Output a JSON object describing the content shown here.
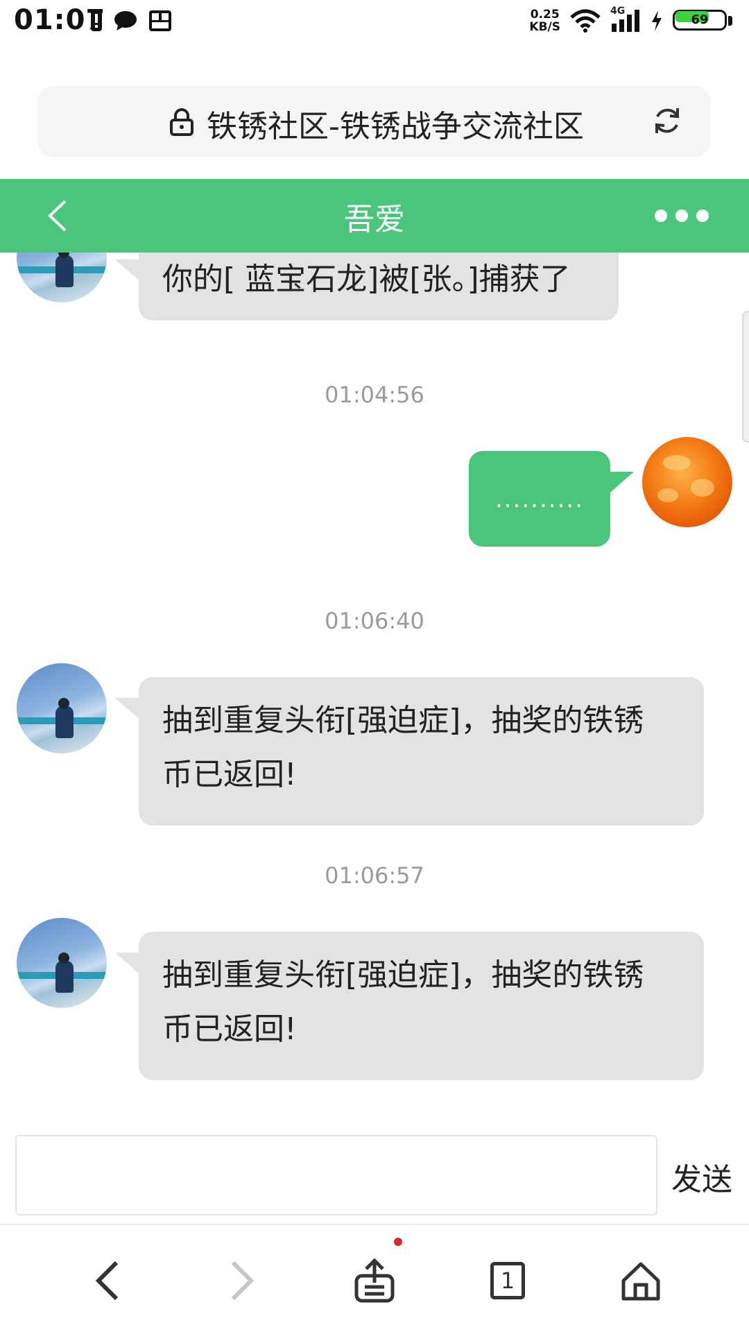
{
  "status_bar": {
    "time": "01:07",
    "net_speed_value": "0.25",
    "net_speed_unit": "KB/S",
    "network_type": "4G",
    "battery_level": "69",
    "icons": [
      "sim-alert-icon",
      "message-icon",
      "gallery-icon",
      "wifi-icon",
      "signal-icon",
      "charging-icon",
      "battery-icon"
    ]
  },
  "browser": {
    "url_title": "铁锈社区-铁锈战争交流社区",
    "tab_count": "1"
  },
  "chat": {
    "title": "吾爱",
    "accent_color": "#4bc47c",
    "messages": [
      {
        "side": "left",
        "text": "你的[ 蓝宝石龙]被[张。]捕获了"
      },
      {
        "timestamp": "01:04:56"
      },
      {
        "side": "right",
        "text": ".........."
      },
      {
        "timestamp": "01:06:40"
      },
      {
        "side": "left",
        "text_line1": "抽到重复头衔[强迫症]，抽奖的铁锈",
        "text_line2": "币已返回!"
      },
      {
        "timestamp": "01:06:57"
      },
      {
        "side": "left",
        "text_line1": "抽到重复头衔[强迫症]，抽奖的铁锈",
        "text_line2": "币已返回!"
      }
    ]
  },
  "composer": {
    "value": "",
    "send_label": "发送"
  }
}
